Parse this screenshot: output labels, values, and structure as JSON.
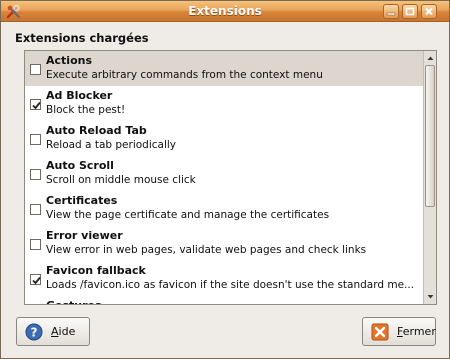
{
  "window": {
    "title": "Extensions"
  },
  "section_label": "Extensions chargées",
  "extensions": [
    {
      "name": "Actions",
      "description": "Execute arbitrary commands from the context menu",
      "checked": false,
      "selected": true
    },
    {
      "name": "Ad Blocker",
      "description": "Block the pest!",
      "checked": true,
      "selected": false
    },
    {
      "name": "Auto Reload Tab",
      "description": "Reload a tab periodically",
      "checked": false,
      "selected": false
    },
    {
      "name": "Auto Scroll",
      "description": "Scroll on middle mouse click",
      "checked": false,
      "selected": false
    },
    {
      "name": "Certificates",
      "description": "View the page certificate and manage the certificates",
      "checked": false,
      "selected": false
    },
    {
      "name": "Error viewer",
      "description": "View error in web pages, validate web pages and check links",
      "checked": false,
      "selected": false
    },
    {
      "name": "Favicon fallback",
      "description": "Loads /favicon.ico as favicon if the site doesn't use the standard me...",
      "checked": true,
      "selected": false
    },
    {
      "name": "Gestures",
      "description": "",
      "checked": false,
      "selected": false
    }
  ],
  "buttons": {
    "help_label": "Aide",
    "close_label": "Fermer"
  },
  "colors": {
    "titlebar_accent": "#e9a35a",
    "selected_row": "#dcd6cf",
    "close_icon": "#e8742a",
    "help_icon": "#3b6cb4"
  }
}
